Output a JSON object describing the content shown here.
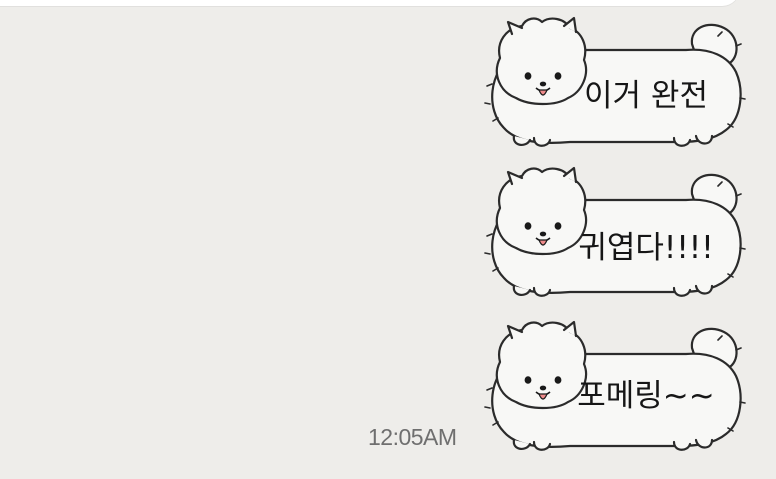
{
  "messages": [
    {
      "text": "이거 완전"
    },
    {
      "text": "귀엽다!!!!"
    },
    {
      "text": "포메링~~"
    }
  ],
  "timestamp": "12:05AM",
  "sticker": {
    "character_icon": "pomeranian-dog-icon",
    "body_color": "#f8f8f6",
    "outline_color": "#2b2b2b",
    "tongue_color": "#ee8a8a"
  },
  "colors": {
    "background": "#eeedea",
    "top_bar": "#ffffff"
  }
}
